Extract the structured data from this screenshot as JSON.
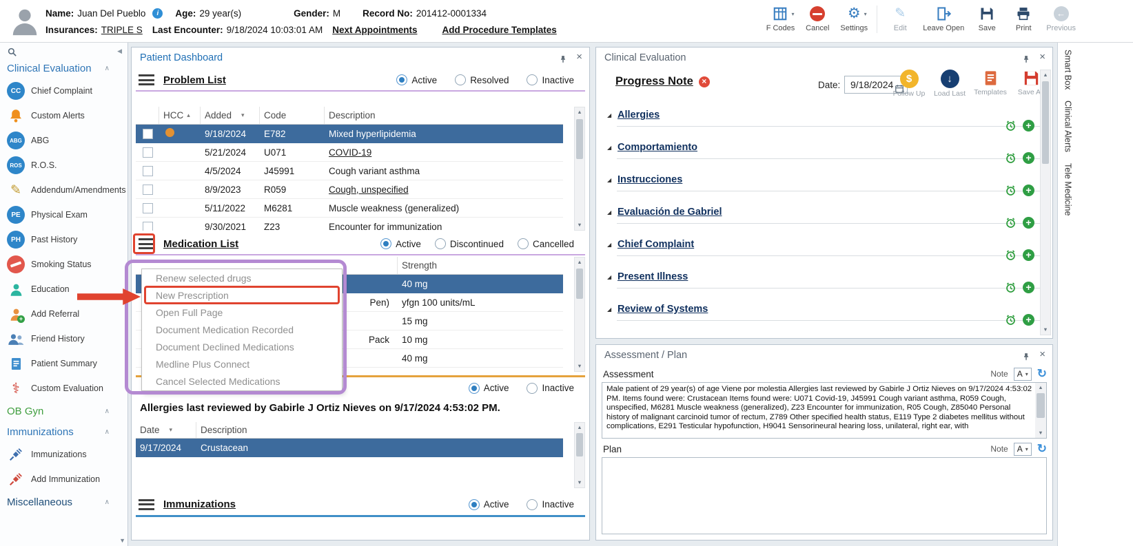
{
  "header": {
    "name_label": "Name:",
    "name": "Juan Del Pueblo",
    "age_label": "Age:",
    "age": "29 year(s)",
    "gender_label": "Gender:",
    "gender": "M",
    "record_label": "Record No:",
    "record_no": "201412-0001334",
    "insurances_label": "Insurances:",
    "insurances": "TRIPLE S",
    "last_encounter_label": "Last Encounter:",
    "last_encounter": "9/18/2024 10:03:01 AM",
    "next_appointments_link": "Next Appointments",
    "add_procedure_templates_link": "Add Procedure Templates",
    "toolbar": {
      "f_codes": "F Codes",
      "cancel": "Cancel",
      "settings": "Settings",
      "edit": "Edit",
      "leave_open": "Leave Open",
      "save": "Save",
      "print": "Print",
      "previous": "Previous"
    }
  },
  "sidebar": {
    "sections": [
      {
        "label": "Clinical Evaluation",
        "items": [
          {
            "label": "Chief Complaint",
            "initials": "CC"
          },
          {
            "label": "Custom Alerts"
          },
          {
            "label": "ABG",
            "initials": "ABG"
          },
          {
            "label": "R.O.S.",
            "initials": "ROS"
          },
          {
            "label": "Addendum/Amendments"
          },
          {
            "label": "Physical Exam",
            "initials": "PE"
          },
          {
            "label": "Past History",
            "initials": "PH"
          },
          {
            "label": "Smoking Status"
          },
          {
            "label": "Education"
          },
          {
            "label": "Add Referral"
          },
          {
            "label": "Friend History"
          },
          {
            "label": "Patient Summary"
          },
          {
            "label": "Custom Evaluation"
          }
        ]
      },
      {
        "label": "OB Gyn",
        "items": []
      },
      {
        "label": "Immunizations",
        "items": [
          {
            "label": "Immunizations"
          },
          {
            "label": "Add Immunization"
          }
        ]
      },
      {
        "label": "Miscellaneous",
        "items": []
      }
    ]
  },
  "dashboard": {
    "title": "Patient Dashboard",
    "problem_list": {
      "title": "Problem List",
      "filters": [
        {
          "label": "Active",
          "selected": true
        },
        {
          "label": "Resolved"
        },
        {
          "label": "Inactive"
        }
      ],
      "columns": {
        "hcc": "HCC",
        "added": "Added",
        "code": "Code",
        "description": "Description"
      },
      "rows": [
        {
          "added": "9/18/2024",
          "code": "E782",
          "description": "Mixed hyperlipidemia",
          "hcc": true,
          "selected": true
        },
        {
          "added": "5/21/2024",
          "code": "U071",
          "description": "COVID-19"
        },
        {
          "added": "4/5/2024",
          "code": "J45991",
          "description": "Cough variant asthma"
        },
        {
          "added": "8/9/2023",
          "code": "R059",
          "description": "Cough, unspecified"
        },
        {
          "added": "5/11/2022",
          "code": "M6281",
          "description": "Muscle weakness (generalized)"
        },
        {
          "added": "9/30/2021",
          "code": "Z23",
          "description": "Encounter for immunization"
        }
      ]
    },
    "medication_list": {
      "title": "Medication List",
      "filters": [
        {
          "label": "Active",
          "selected": true
        },
        {
          "label": "Discontinued"
        },
        {
          "label": "Cancelled"
        }
      ],
      "strength_column": "Strength",
      "rows": [
        {
          "name_tail": "",
          "strength": "40 mg",
          "selected": true
        },
        {
          "name_tail": "Pen)",
          "strength": "yfgn 100 units/mL"
        },
        {
          "name_tail": "",
          "strength": "15 mg"
        },
        {
          "name_tail": "Pack",
          "strength": "10 mg"
        },
        {
          "name_tail": "",
          "strength": "40 mg"
        }
      ]
    },
    "medication_menu": {
      "items": [
        "Renew selected drugs",
        "New Prescription",
        "Open Full Page",
        "Document Medication Recorded",
        "Document Declined Medications",
        "Medline Plus Connect",
        "Cancel Selected Medications"
      ],
      "highlighted": "New Prescription"
    },
    "allergies": {
      "filters": [
        {
          "label": "Active",
          "selected": true
        },
        {
          "label": "Inactive"
        }
      ],
      "reviewed_text": "Allergies last reviewed by Gabirle J Ortiz Nieves on 9/17/2024 4:53:02 PM.",
      "columns": {
        "date": "Date",
        "description": "Description"
      },
      "rows": [
        {
          "date": "9/17/2024",
          "description": "Crustacean",
          "selected": true
        }
      ]
    },
    "immunizations": {
      "title": "Immunizations",
      "filters": [
        {
          "label": "Active",
          "selected": true
        },
        {
          "label": "Inactive"
        }
      ]
    }
  },
  "clinical_evaluation": {
    "title": "Clinical Evaluation",
    "note_title": "Progress Note",
    "date_label": "Date:",
    "date_value": "9/18/2024",
    "actions": [
      {
        "label": "Follow Up"
      },
      {
        "label": "Load Last"
      },
      {
        "label": "Templates"
      },
      {
        "label": "Save As"
      }
    ],
    "sections": [
      {
        "label": "Allergies"
      },
      {
        "label": "Comportamiento"
      },
      {
        "label": "Instrucciones"
      },
      {
        "label": "Evaluación de Gabriel"
      },
      {
        "label": "Chief Complaint"
      },
      {
        "label": "Present Illness"
      },
      {
        "label": "Review of Systems"
      }
    ]
  },
  "assessment_plan": {
    "title": "Assessment / Plan",
    "assessment_label": "Assessment",
    "plan_label": "Plan",
    "note_label": "Note",
    "note_selector": "A",
    "assessment_text": "Male patient of 29 year(s) of age Viene por molestia    Allergies last reviewed by Gabirle J Ortiz Nieves on 9/17/2024 4:53:02 PM.   Items found were:  Crustacean   Items found were:  U071 Covid-19, J45991 Cough variant asthma, R059 Cough, unspecified, M6281 Muscle weakness (generalized), Z23 Encounter for immunization, R05 Cough, Z85040 Personal history of malignant carcinoid tumor of rectum, Z789 Other specified health status, E119 Type 2 diabetes mellitus without complications, E291 Testicular hypofunction, H9041 Sensorineural hearing loss, unilateral, right ear, with",
    "plan_text": ""
  },
  "side_tabs": [
    {
      "label": "Smart Box"
    },
    {
      "label": "Clinical Alerts"
    },
    {
      "label": "Tele Medicine"
    }
  ]
}
